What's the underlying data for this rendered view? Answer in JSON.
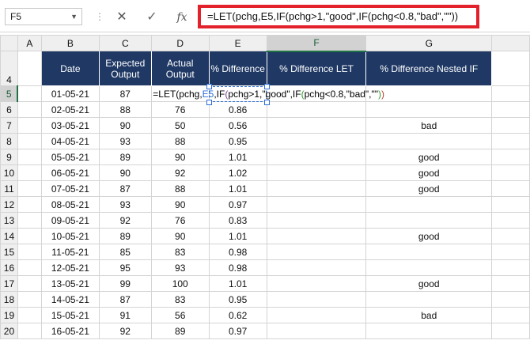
{
  "formula_bar": {
    "name_box": "F5",
    "cancel_icon": "✕",
    "enter_icon": "✓",
    "fx_label": "fx",
    "formula": "=LET(pchg,E5,IF(pchg>1,\"good\",IF(pchg<0.8,\"bad\",\"\"))"
  },
  "columns": [
    "A",
    "B",
    "C",
    "D",
    "E",
    "F",
    "G"
  ],
  "header_row": {
    "row": "4",
    "date": "Date",
    "expected": "Expected Output",
    "actual": "Actual Output",
    "pct": "% Difference",
    "let": "% Difference LET",
    "nested": "% Difference Nested IF"
  },
  "editing_formula": {
    "part1": "=LET(pchg,",
    "ref": "E5",
    "part2": ",IF",
    "p1_open": "(",
    "part3": "pchg>1,\"good\",IF",
    "p2_open": "(",
    "part4": "pchg<0.8,\"bad\",\"\"",
    "p2_close": ")",
    "p1_close": ")"
  },
  "rows": [
    {
      "row": "5",
      "date": "01-05-21",
      "expected": "87",
      "actual": "",
      "pct": "",
      "let": "",
      "nested": ""
    },
    {
      "row": "6",
      "date": "02-05-21",
      "expected": "88",
      "actual": "76",
      "pct": "0.86",
      "let": "",
      "nested": ""
    },
    {
      "row": "7",
      "date": "03-05-21",
      "expected": "90",
      "actual": "50",
      "pct": "0.56",
      "let": "",
      "nested": "bad"
    },
    {
      "row": "8",
      "date": "04-05-21",
      "expected": "93",
      "actual": "88",
      "pct": "0.95",
      "let": "",
      "nested": ""
    },
    {
      "row": "9",
      "date": "05-05-21",
      "expected": "89",
      "actual": "90",
      "pct": "1.01",
      "let": "",
      "nested": "good"
    },
    {
      "row": "10",
      "date": "06-05-21",
      "expected": "90",
      "actual": "92",
      "pct": "1.02",
      "let": "",
      "nested": "good"
    },
    {
      "row": "11",
      "date": "07-05-21",
      "expected": "87",
      "actual": "88",
      "pct": "1.01",
      "let": "",
      "nested": "good"
    },
    {
      "row": "12",
      "date": "08-05-21",
      "expected": "93",
      "actual": "90",
      "pct": "0.97",
      "let": "",
      "nested": ""
    },
    {
      "row": "13",
      "date": "09-05-21",
      "expected": "92",
      "actual": "76",
      "pct": "0.83",
      "let": "",
      "nested": ""
    },
    {
      "row": "14",
      "date": "10-05-21",
      "expected": "89",
      "actual": "90",
      "pct": "1.01",
      "let": "",
      "nested": "good"
    },
    {
      "row": "15",
      "date": "11-05-21",
      "expected": "85",
      "actual": "83",
      "pct": "0.98",
      "let": "",
      "nested": ""
    },
    {
      "row": "16",
      "date": "12-05-21",
      "expected": "95",
      "actual": "93",
      "pct": "0.98",
      "let": "",
      "nested": ""
    },
    {
      "row": "17",
      "date": "13-05-21",
      "expected": "99",
      "actual": "100",
      "pct": "1.01",
      "let": "",
      "nested": "good"
    },
    {
      "row": "18",
      "date": "14-05-21",
      "expected": "87",
      "actual": "83",
      "pct": "0.95",
      "let": "",
      "nested": ""
    },
    {
      "row": "19",
      "date": "15-05-21",
      "expected": "91",
      "actual": "56",
      "pct": "0.62",
      "let": "",
      "nested": "bad"
    },
    {
      "row": "20",
      "date": "16-05-21",
      "expected": "92",
      "actual": "89",
      "pct": "0.97",
      "let": "",
      "nested": ""
    }
  ]
}
